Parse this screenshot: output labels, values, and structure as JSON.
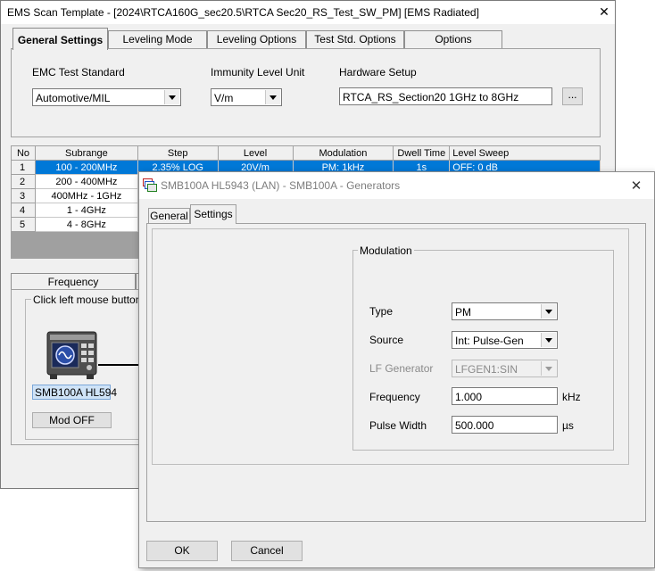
{
  "main_window": {
    "title": "EMS Scan Template - [2024\\RTCA160G_sec20.5\\RTCA Sec20_RS_Test_SW_PM] [EMS Radiated]",
    "close": "✕",
    "tabs": [
      "General Settings",
      "Leveling Mode",
      "Leveling Options",
      "Test Std. Options",
      "Options"
    ],
    "emc_label": "EMC Test Standard",
    "emc_value": "Automotive/MIL",
    "unit_label": "Immunity Level Unit",
    "unit_value": "V/m",
    "hw_label": "Hardware Setup",
    "hw_value": "RTCA_RS_Section20 1GHz to 8GHz",
    "browse_button": "...",
    "table": {
      "columns": [
        "No",
        "Subrange",
        "Step",
        "Level",
        "Modulation",
        "Dwell Time",
        "Level Sweep"
      ],
      "rows": [
        {
          "no": "1",
          "subrange": "100 - 200MHz",
          "step": "2.35% LOG",
          "level": "20V/m",
          "modulation": "PM: 1kHz",
          "dwell": "1s",
          "sweep": "OFF: 0 dB"
        },
        {
          "no": "2",
          "subrange": "200 - 400MHz"
        },
        {
          "no": "3",
          "subrange": "400MHz - 1GHz"
        },
        {
          "no": "4",
          "subrange": "1 - 4GHz"
        },
        {
          "no": "5",
          "subrange": "4 - 8GHz"
        }
      ]
    },
    "freq_tab": "Frequency",
    "hint": "Click left mouse button to",
    "device_label": "SMB100A HL594",
    "mod_off_button": "Mod OFF"
  },
  "dialog": {
    "title": "SMB100A HL5943 (LAN) - SMB100A - Generators",
    "close": "✕",
    "tabs": [
      "General",
      "Settings"
    ],
    "group_title": "Modulation",
    "type_label": "Type",
    "type_value": "PM",
    "source_label": "Source",
    "source_value": "Int: Pulse-Gen",
    "lf_label": "LF Generator",
    "lf_value": "LFGEN1:SIN",
    "freq_label": "Frequency",
    "freq_value": "1.000",
    "freq_unit": "kHz",
    "pw_label": "Pulse Width",
    "pw_value": "500.000",
    "pw_unit": "µs",
    "ok": "OK",
    "cancel": "Cancel"
  }
}
